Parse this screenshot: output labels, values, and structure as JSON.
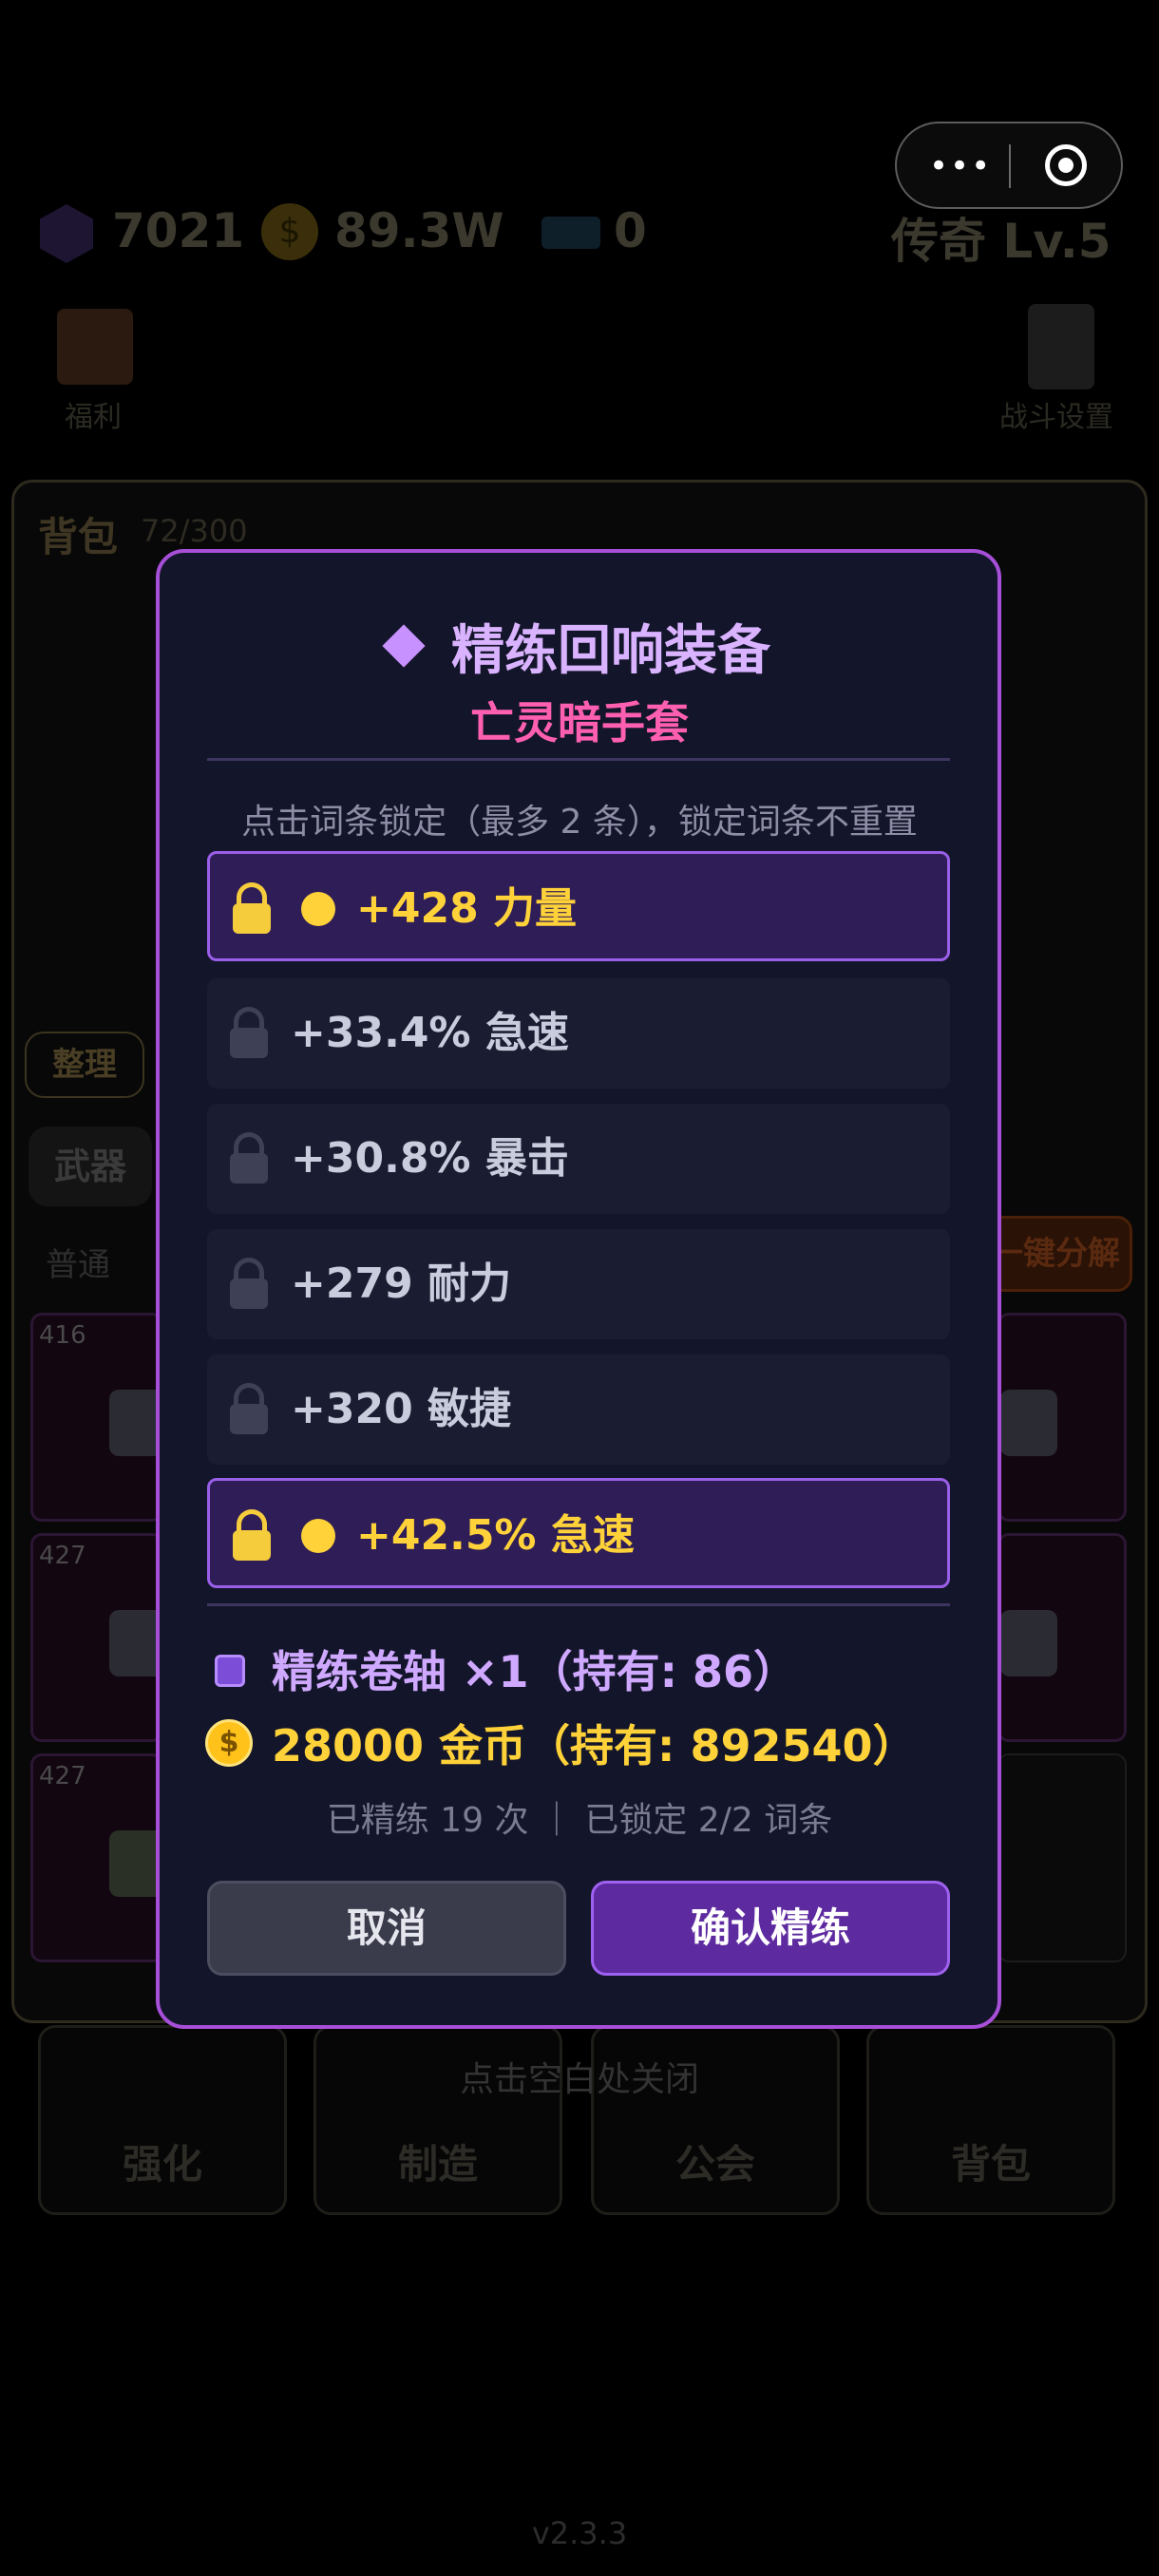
{
  "header": {
    "gems": "7021",
    "gold": "89.3W",
    "tickets": "0",
    "rank": "传奇 Lv.5",
    "welfare_label": "福利",
    "battle_settings_label": "战斗设置"
  },
  "bag": {
    "title": "背包",
    "capacity": "72/300",
    "sort_label": "整理",
    "tab_weapon": "武器",
    "filter_normal": "普通",
    "dismantle_label": "一键分解",
    "slot_levels": [
      "416",
      "427",
      "427"
    ]
  },
  "modal": {
    "title": "精练回响装备",
    "item_name": "亡灵暗手套",
    "hint": "点击词条锁定（最多 2 条），锁定词条不重置",
    "affixes": [
      {
        "text": "+428 力量",
        "locked": true
      },
      {
        "text": "+33.4% 急速",
        "locked": false
      },
      {
        "text": "+30.8% 暴击",
        "locked": false
      },
      {
        "text": "+279 耐力",
        "locked": false
      },
      {
        "text": "+320 敏捷",
        "locked": false
      },
      {
        "text": "+42.5% 急速",
        "locked": true
      }
    ],
    "cost_scroll": "精练卷轴 ×1（持有: 86）",
    "cost_gold": "28000 金币（持有: 892540）",
    "stats": "已精练 19 次 ｜ 已锁定 2/2 词条",
    "cancel_label": "取消",
    "confirm_label": "确认精练"
  },
  "close_hint": "点击空白处关闭",
  "bottom_nav": [
    "强化",
    "制造",
    "公会",
    "背包"
  ],
  "version": "v2.3.3",
  "colors": {
    "accent_purple": "#a74fd8",
    "gold": "#ffd23a",
    "item_pink": "#ff5fb0"
  }
}
